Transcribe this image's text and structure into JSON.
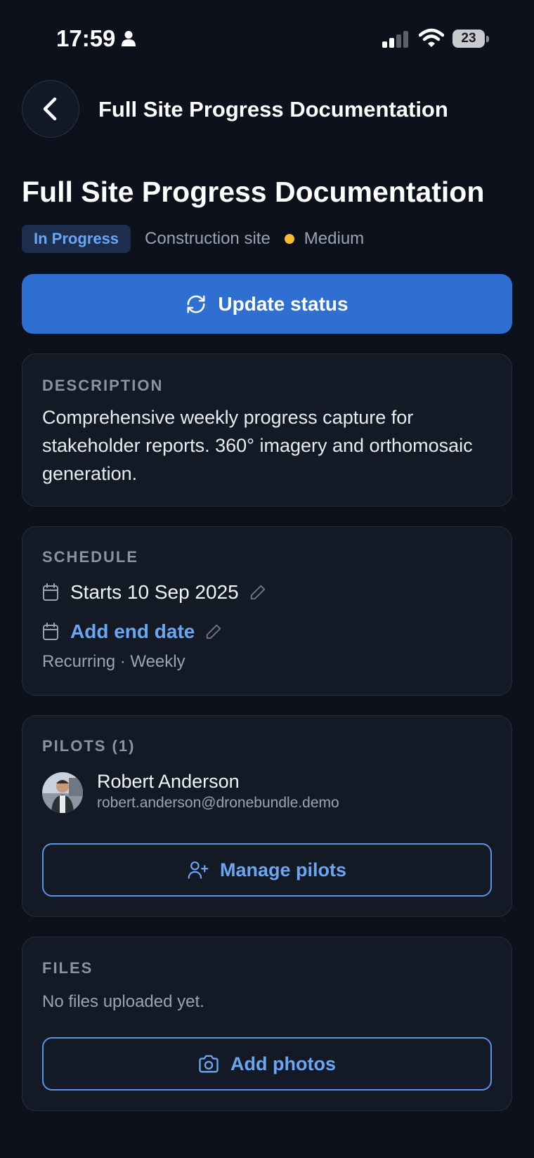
{
  "status_bar": {
    "time": "17:59",
    "battery": "23"
  },
  "nav": {
    "title": "Full Site Progress Documentation"
  },
  "header": {
    "title": "Full Site Progress Documentation",
    "status": "In Progress",
    "category": "Construction site",
    "priority": "Medium"
  },
  "actions": {
    "update_status": "Update status"
  },
  "description": {
    "label": "DESCRIPTION",
    "text": "Comprehensive weekly progress capture for stakeholder reports. 360° imagery and orthomosaic generation."
  },
  "schedule": {
    "label": "SCHEDULE",
    "start": "Starts 10 Sep 2025",
    "end_action": "Add end date",
    "recurrence": "Recurring · Weekly"
  },
  "pilots": {
    "label": "PILOTS (1)",
    "items": [
      {
        "name": "Robert Anderson",
        "email": "robert.anderson@dronebundle.demo"
      }
    ],
    "manage_label": "Manage pilots"
  },
  "files": {
    "label": "FILES",
    "empty_text": "No files uploaded yet.",
    "add_label": "Add photos"
  },
  "colors": {
    "background": "#0c111c",
    "card": "#131a26",
    "accent": "#2f6fd2",
    "link": "#6ba6f2",
    "priority_medium": "#f6bd32"
  }
}
